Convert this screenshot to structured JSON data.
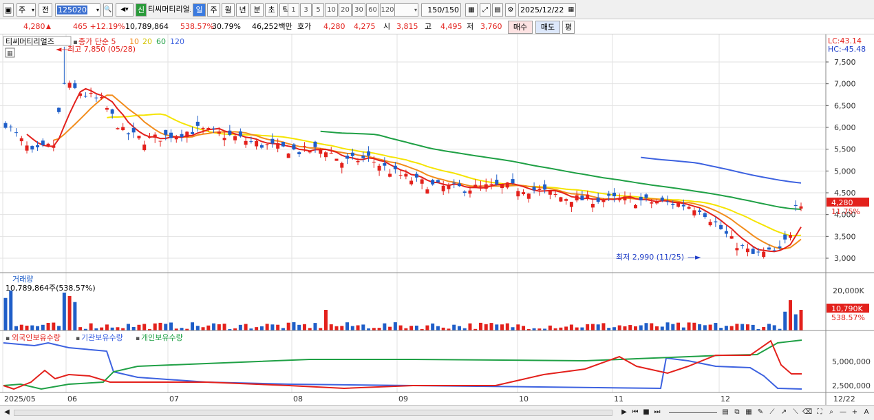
{
  "toolbar": {
    "type_select": "주",
    "prev_label": "전",
    "code": "125020",
    "stock_name": "티씨머티리얼즈",
    "new_label": "신",
    "periods": [
      "일",
      "주",
      "월",
      "년",
      "분",
      "초",
      "틱"
    ],
    "minute_options": [
      "1",
      "3",
      "5",
      "10",
      "20",
      "30",
      "60",
      "120"
    ],
    "count": "150",
    "count_total": "/150",
    "date": "2025/12/22"
  },
  "info": {
    "price": "4,280",
    "change": "465 +12.19%",
    "volume": "10,789,864",
    "volume_ratio": "538.57%",
    "turnover": "30.79%",
    "amount": "46,252백만",
    "ask_label": "호가",
    "ask1": "4,280",
    "ask2": "4,275",
    "open_label": "시",
    "open": "3,815",
    "high_label": "고",
    "high": "4,495",
    "low_label": "저",
    "low": "3,760",
    "buy_label": "매수",
    "sell_label": "매도",
    "avg_label": "평"
  },
  "price_panel": {
    "title": "티씨머티리얼즈",
    "ma_label": "종가 단순 5",
    "ma_periods": [
      "10",
      "20",
      "60",
      "120"
    ],
    "max_label": "최고 7,850 (05/28)",
    "min_label": "최저 2,990 (11/25)",
    "lc": "LC:43.14",
    "hc": "HC:-45.48",
    "last_price": "4,280",
    "last_pct": "11.75%"
  },
  "volume_panel": {
    "title": "거래량",
    "value_label": "10,789,864주(538.57%)",
    "axis_tick": "20,000K",
    "last_label": "10,790K",
    "last_pct": "538.57%"
  },
  "holding_panel": {
    "legend": [
      "외국인보유수량",
      "기관보유수량",
      "개인보유수량"
    ],
    "ticks": [
      "5,000,000",
      "2,500,000"
    ]
  },
  "x_axis": {
    "labels": [
      "2025/05",
      "06",
      "07",
      "08",
      "09",
      "10",
      "11",
      "12"
    ],
    "last": "12/22"
  },
  "chart_data": {
    "type": "candlestick",
    "y_ticks": [
      7500,
      7000,
      6500,
      6000,
      5500,
      5000,
      4500,
      4000,
      3500,
      3000
    ],
    "ylim": [
      2590,
      7900
    ],
    "high": 7850,
    "low": 2990,
    "ma_colors": {
      "ma5": "#e3211c",
      "ma10": "#f28c1b",
      "ma20": "#f5e400",
      "ma60": "#1fa045",
      "ma120": "#3d62e0"
    },
    "candles": [
      [
        5,
        5,
        5,
        6,
        5
      ],
      [
        30,
        30,
        30,
        30,
        30
      ],
      [
        60,
        60,
        58,
        58,
        60
      ],
      [
        100,
        100,
        100,
        100,
        100
      ]
    ]
  },
  "colors": {
    "up": "#e3211c",
    "down": "#1f5ec8",
    "accent": "#2b6fd8"
  }
}
